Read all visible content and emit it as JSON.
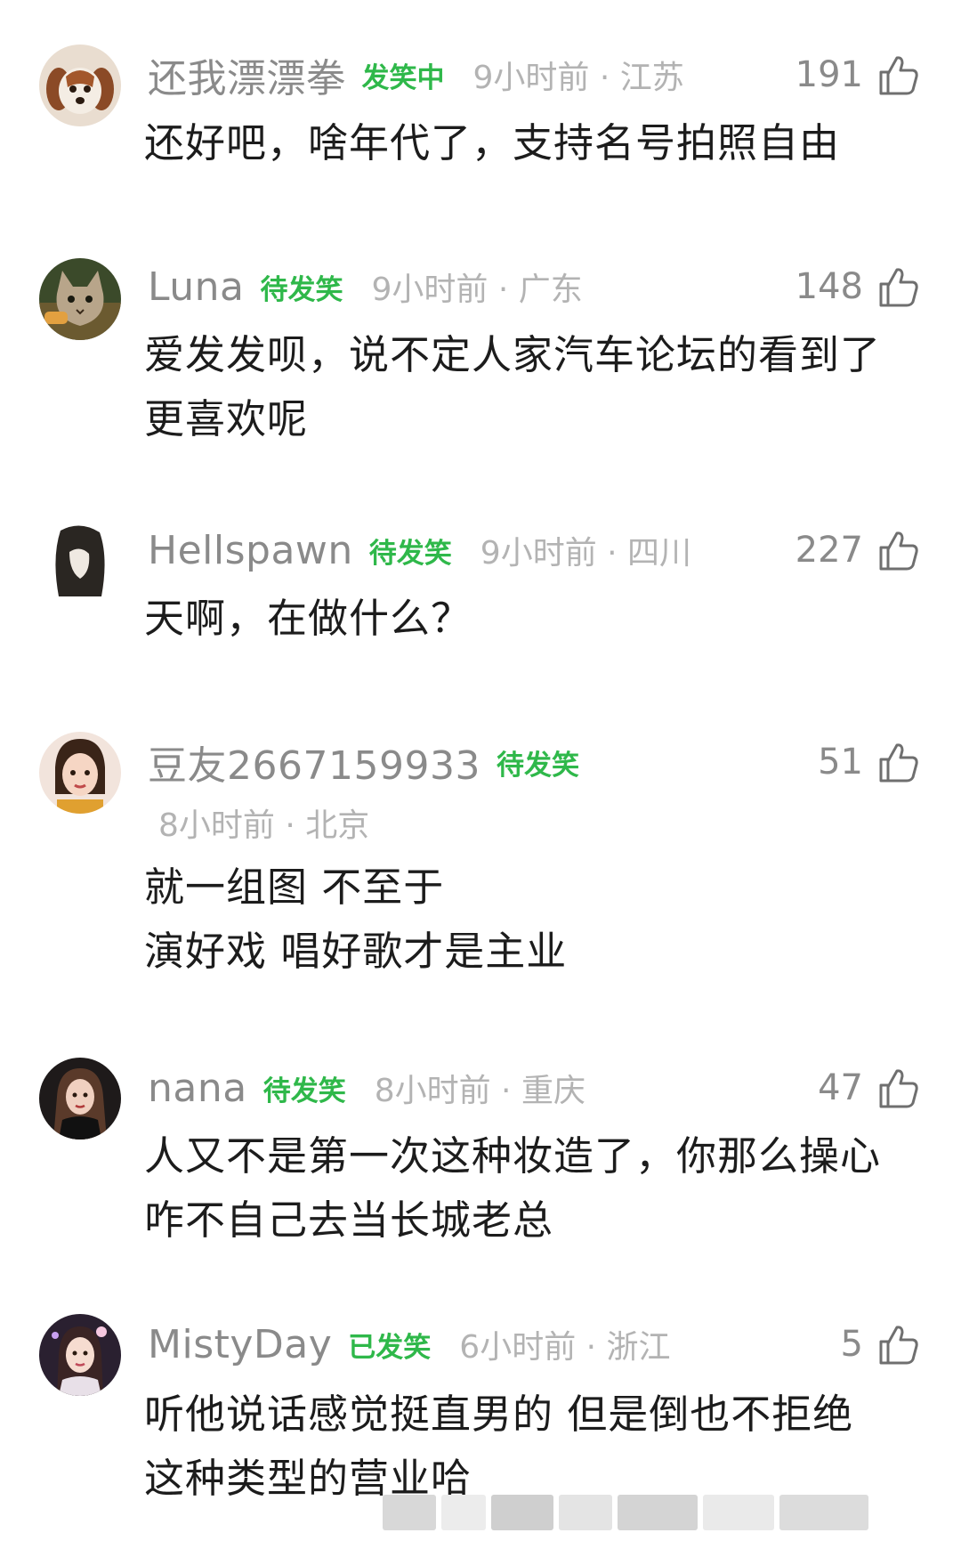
{
  "comments": [
    {
      "username": "还我漂漂拳",
      "badge": "发笑中",
      "time_location": "9小时前 · 江苏",
      "likes": "191",
      "text_lines": [
        "还好吧，啥年代了，支持名号拍照自由"
      ],
      "avatar_icon": "dog-avatar-icon"
    },
    {
      "username": "Luna",
      "badge": "待发笑",
      "time_location": "9小时前 · 广东",
      "likes": "148",
      "text_lines": [
        "爱发发呗，说不定人家汽车论坛的看到了",
        "更喜欢呢"
      ],
      "avatar_icon": "cat-avatar-icon"
    },
    {
      "username": "Hellspawn",
      "badge": "待发笑",
      "time_location": "9小时前 · 四川",
      "likes": "227",
      "text_lines": [
        "天啊，在做什么？"
      ],
      "avatar_icon": "hooded-figure-avatar-icon"
    },
    {
      "username": "豆友2667159933",
      "badge": "待发笑",
      "time_location": "8小时前 · 北京",
      "likes": "51",
      "text_lines": [
        "就一组图 不至于",
        "演好戏 唱好歌才是主业"
      ],
      "avatar_icon": "woman-portrait-avatar-icon"
    },
    {
      "username": "nana",
      "badge": "待发笑",
      "time_location": "8小时前 · 重庆",
      "likes": "47",
      "text_lines": [
        "人又不是第一次这种妆造了，你那么操心",
        "咋不自己去当长城老总"
      ],
      "avatar_icon": "woman-dark-portrait-avatar-icon"
    },
    {
      "username": "MistyDay",
      "badge": "已发笑",
      "time_location": "6小时前 · 浙江",
      "likes": "5",
      "text_lines": [
        "听他说话感觉挺直男的 但是倒也不拒绝",
        "这种类型的营业哈"
      ],
      "avatar_icon": "woman-night-portrait-avatar-icon"
    }
  ],
  "colors": {
    "username": "#8a8a8a",
    "badge": "#2fb84a",
    "meta": "#b3b3b3",
    "text": "#1c1c1c",
    "background": "#ffffff"
  },
  "like_icon": "thumbs-up-icon"
}
